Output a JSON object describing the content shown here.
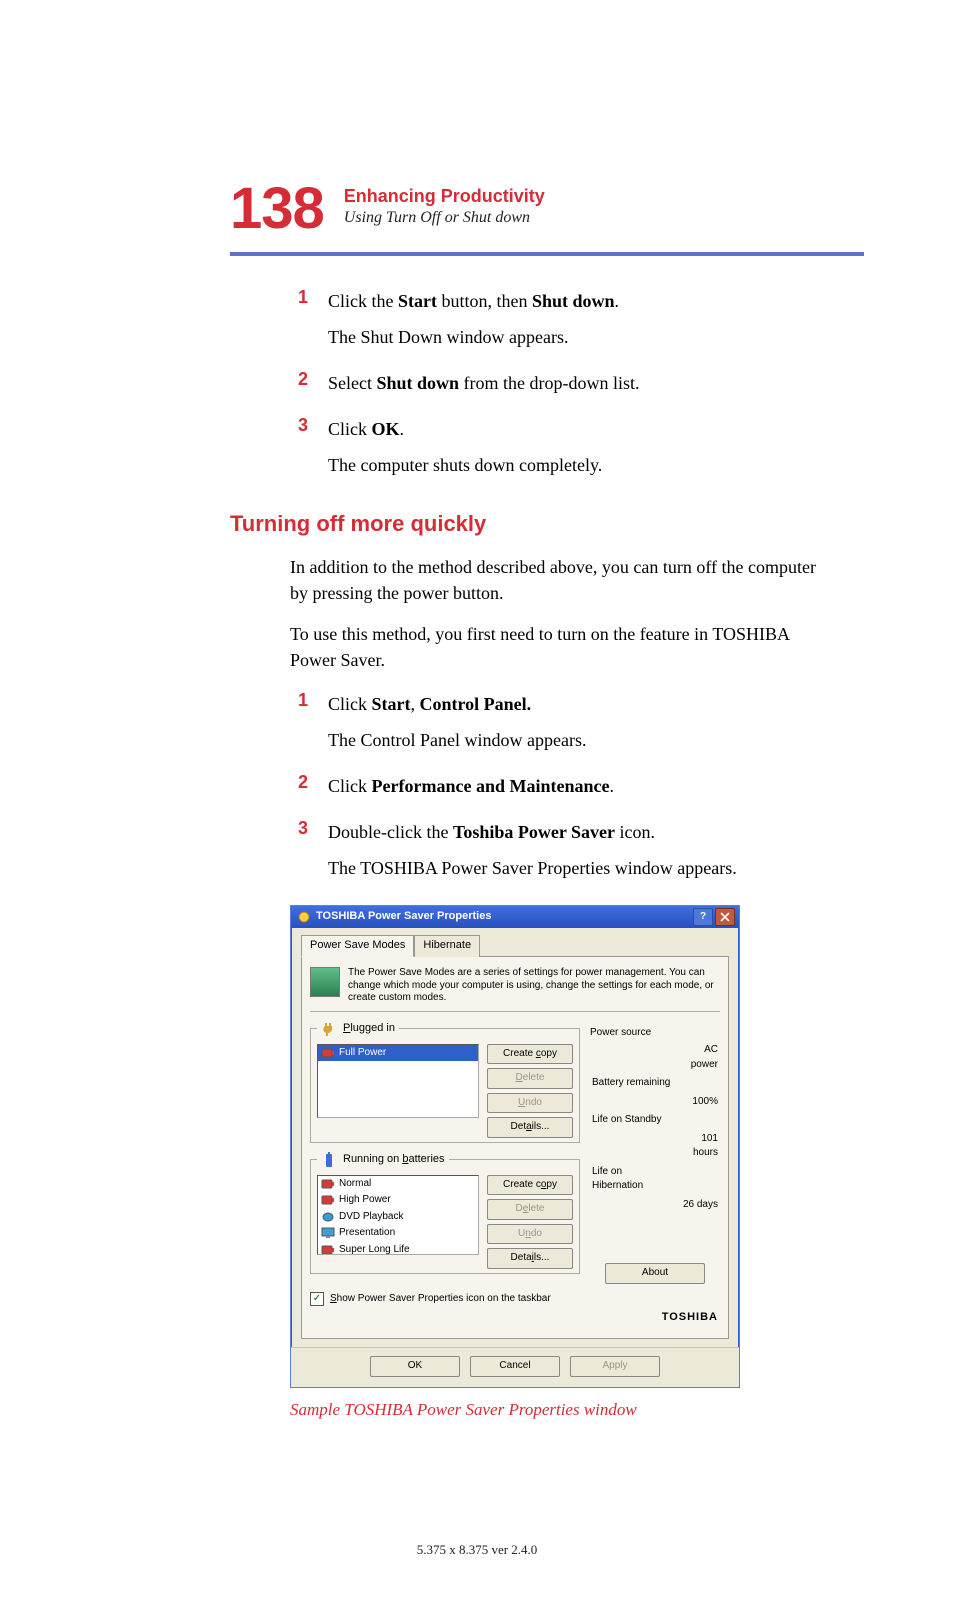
{
  "header": {
    "page_number": "138",
    "chapter": "Enhancing Productivity",
    "section": "Using Turn Off or Shut down"
  },
  "steps_top": {
    "s1": {
      "num": "1",
      "pre": "Click the ",
      "b1": "Start",
      "mid": " button, then ",
      "b2": "Shut down",
      "post": ".",
      "sub": "The Shut Down window appears."
    },
    "s2": {
      "num": "2",
      "pre": "Select ",
      "b1": "Shut down",
      "post": " from the drop-down list."
    },
    "s3": {
      "num": "3",
      "pre": "Click ",
      "b1": "OK",
      "post": ".",
      "sub": "The computer shuts down completely."
    }
  },
  "h2": "Turning off more quickly",
  "paras": {
    "p1": "In addition to the method described above, you can turn off the computer by pressing the power button.",
    "p2": "To use this method, you first need to turn on the feature in TOSHIBA Power Saver."
  },
  "steps_bottom": {
    "s1": {
      "num": "1",
      "pre": "Click ",
      "b1": "Start",
      "mid": ", ",
      "b2": "Control Panel.",
      "sub": "The Control Panel window appears."
    },
    "s2": {
      "num": "2",
      "pre": "Click ",
      "b1": "Performance and Maintenance",
      "post": "."
    },
    "s3": {
      "num": "3",
      "pre": "Double-click the ",
      "b1": "Toshiba Power Saver",
      "post": " icon.",
      "sub": "The TOSHIBA Power Saver Properties window appears."
    }
  },
  "dialog": {
    "title": "TOSHIBA Power Saver Properties",
    "tabs": {
      "active": "Power Save Modes",
      "other": "Hibernate"
    },
    "description": "The Power Save Modes are a series of settings for power management. You can change which mode your computer is using, change the settings for each mode, or create custom modes.",
    "plugged": {
      "legend": "Plugged in",
      "items": [
        {
          "label": "Full Power",
          "selected": true,
          "color": "#d43b3b",
          "shape": "battery"
        }
      ],
      "buttons": {
        "create": "Create copy",
        "delete": "Delete",
        "undo": "Undo",
        "details": "Details..."
      }
    },
    "batteries": {
      "legend": "Running on batteries",
      "items": [
        {
          "label": "Normal",
          "color": "#d43b3b",
          "shape": "battery"
        },
        {
          "label": "High Power",
          "color": "#d43b3b",
          "shape": "battery"
        },
        {
          "label": "DVD Playback",
          "color": "#2f9fd8",
          "shape": "disc"
        },
        {
          "label": "Presentation",
          "color": "#3b9fd8",
          "shape": "screen"
        },
        {
          "label": "Super Long Life",
          "color": "#d43b3b",
          "shape": "battery"
        }
      ],
      "buttons": {
        "create": "Create copy",
        "delete": "Delete",
        "undo": "Undo",
        "details": "Details..."
      }
    },
    "status": {
      "title": "Power source",
      "rows": [
        {
          "label": "",
          "value": "AC power"
        },
        {
          "label": "Battery remaining",
          "value": ""
        },
        {
          "label": "",
          "value": "100%"
        },
        {
          "label": "Life on Standby",
          "value": ""
        },
        {
          "label": "",
          "value": "101 hours"
        },
        {
          "label": "Life on Hibernation",
          "value": ""
        },
        {
          "label": "",
          "value": "26 days"
        }
      ],
      "about": "About"
    },
    "checkbox_label": "Show Power Saver Properties icon on the taskbar",
    "brand": "TOSHIBA",
    "footer": {
      "ok": "OK",
      "cancel": "Cancel",
      "apply": "Apply"
    }
  },
  "figure_caption": "Sample TOSHIBA Power Saver Properties window",
  "footer_version": "5.375 x 8.375 ver 2.4.0"
}
